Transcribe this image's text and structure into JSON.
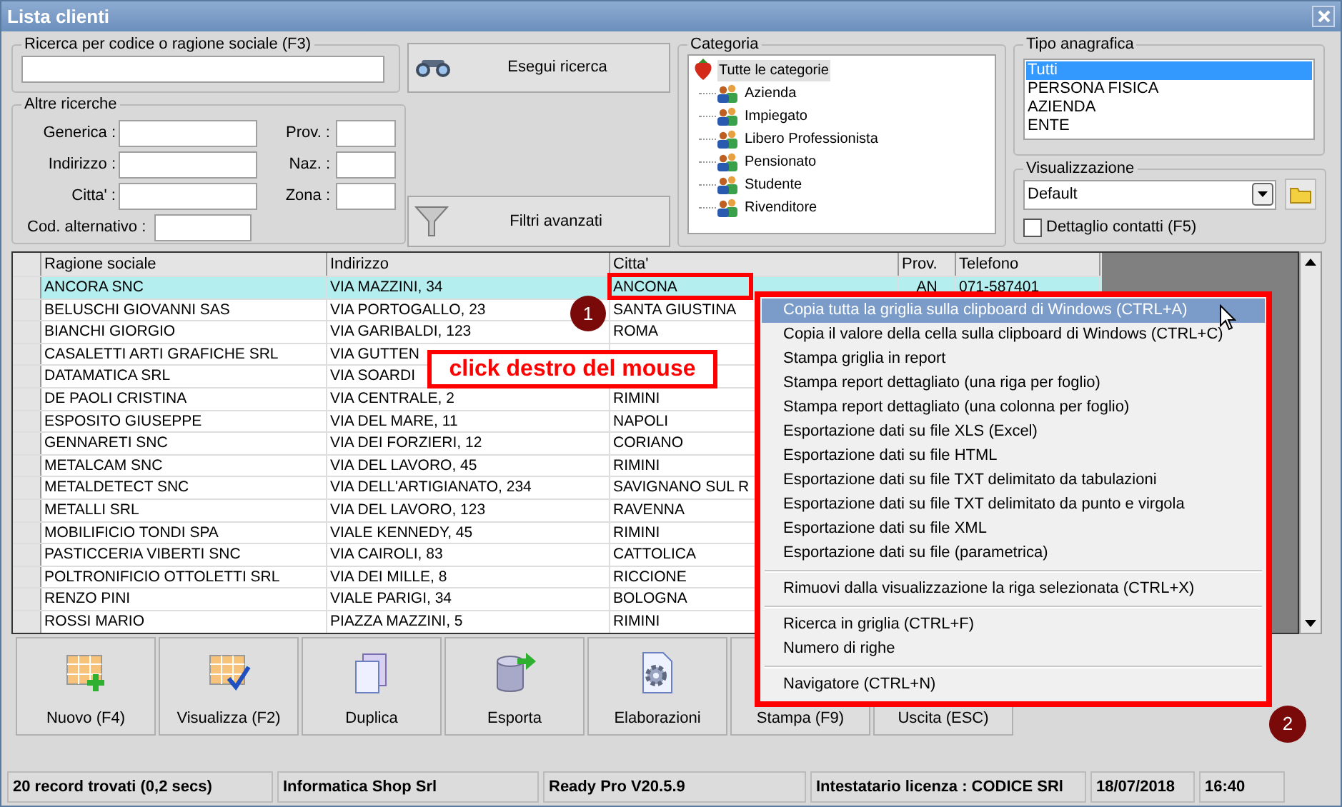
{
  "window": {
    "title": "Lista clienti"
  },
  "search": {
    "legend": "Ricerca per codice o ragione sociale (F3)",
    "button": "Esegui ricerca"
  },
  "other_search": {
    "legend": "Altre ricerche",
    "fields": [
      {
        "label": "Generica :",
        "side_label": "Prov. :"
      },
      {
        "label": "Indirizzo :",
        "side_label": "Naz. :"
      },
      {
        "label": "Citta' :",
        "side_label": "Zona :"
      },
      {
        "label": "Cod. alternativo :"
      }
    ],
    "button": "Filtri avanzati"
  },
  "categoria": {
    "legend": "Categoria",
    "root": {
      "label": "Tutte le categorie",
      "selected": true,
      "children": [
        {
          "label": "Azienda",
          "selected": false
        },
        {
          "label": "Impiegato",
          "selected": false
        },
        {
          "label": "Libero Professionista",
          "selected": false
        },
        {
          "label": "Pensionato",
          "selected": false
        },
        {
          "label": "Studente",
          "selected": false
        },
        {
          "label": "Rivenditore",
          "selected": false
        }
      ]
    }
  },
  "tipo_anagrafica": {
    "legend": "Tipo anagrafica",
    "items": [
      {
        "label": "Tutti",
        "selected": true
      },
      {
        "label": "PERSONA FISICA",
        "selected": false
      },
      {
        "label": "AZIENDA",
        "selected": false
      },
      {
        "label": "ENTE",
        "selected": false
      }
    ]
  },
  "visualizzazione": {
    "legend": "Visualizzazione",
    "value": "Default",
    "checkbox": {
      "label": "Dettaglio contatti (F5)",
      "checked": false
    }
  },
  "table": {
    "columns": [
      "Ragione sociale",
      "Indirizzo",
      "Citta'",
      "Prov.",
      "Telefono"
    ],
    "rows": [
      {
        "cells": [
          "ANCORA SNC",
          "VIA MAZZINI, 34",
          "ANCONA",
          "AN",
          "071-587401"
        ],
        "selected": true
      },
      {
        "cells": [
          "BELUSCHI GIOVANNI SAS",
          "VIA PORTOGALLO, 23",
          "SANTA GIUSTINA"
        ],
        "selected": false
      },
      {
        "cells": [
          "BIANCHI GIORGIO",
          "VIA GARIBALDI, 123",
          "ROMA"
        ],
        "selected": false
      },
      {
        "cells": [
          "CASALETTI ARTI GRAFICHE SRL",
          "VIA GUTTEN"
        ],
        "selected": false
      },
      {
        "cells": [
          "DATAMATICA SRL",
          "VIA SOARDI"
        ],
        "selected": false
      },
      {
        "cells": [
          "DE PAOLI CRISTINA",
          "VIA CENTRALE, 2",
          "RIMINI"
        ],
        "selected": false
      },
      {
        "cells": [
          "ESPOSITO GIUSEPPE",
          "VIA DEL MARE, 11",
          "NAPOLI"
        ],
        "selected": false
      },
      {
        "cells": [
          "GENNARETI SNC",
          "VIA DEI FORZIERI, 12",
          "CORIANO"
        ],
        "selected": false
      },
      {
        "cells": [
          "METALCAM SNC",
          "VIA DEL LAVORO, 45",
          "RIMINI"
        ],
        "selected": false
      },
      {
        "cells": [
          "METALDETECT SNC",
          "VIA DELL'ARTIGIANATO, 234",
          "SAVIGNANO SUL R"
        ],
        "selected": false
      },
      {
        "cells": [
          "METALLI SRL",
          "VIA DEL LAVORO, 123",
          "RAVENNA"
        ],
        "selected": false
      },
      {
        "cells": [
          "MOBILIFICIO TONDI SPA",
          "VIALE KENNEDY, 45",
          "RIMINI"
        ],
        "selected": false
      },
      {
        "cells": [
          "PASTICCERIA VIBERTI SNC",
          "VIA CAIROLI, 83",
          "CATTOLICA"
        ],
        "selected": false
      },
      {
        "cells": [
          "POLTRONIFICIO OTTOLETTI SRL",
          "VIA DEI MILLE, 8",
          "RICCIONE"
        ],
        "selected": false
      },
      {
        "cells": [
          "RENZO PINI",
          "VIALE PARIGI, 34",
          "BOLOGNA"
        ],
        "selected": false
      },
      {
        "cells": [
          "ROSSI MARIO",
          "PIAZZA MAZZINI, 5",
          "RIMINI"
        ],
        "selected": false
      }
    ]
  },
  "context_menu": {
    "items": [
      {
        "kind": "item",
        "label": "Copia tutta la griglia sulla clipboard di Windows (CTRL+A)",
        "selected": true
      },
      {
        "kind": "item",
        "label": "Copia il valore della cella sulla clipboard di Windows (CTRL+C)",
        "selected": false
      },
      {
        "kind": "item",
        "label": "Stampa griglia in report",
        "selected": false
      },
      {
        "kind": "item",
        "label": "Stampa report dettagliato (una riga per foglio)",
        "selected": false
      },
      {
        "kind": "item",
        "label": "Stampa report dettagliato (una colonna per foglio)",
        "selected": false
      },
      {
        "kind": "item",
        "label": "Esportazione dati su file XLS (Excel)",
        "selected": false
      },
      {
        "kind": "item",
        "label": "Esportazione dati su file HTML",
        "selected": false
      },
      {
        "kind": "item",
        "label": "Esportazione dati su file TXT delimitato da tabulazioni",
        "selected": false
      },
      {
        "kind": "item",
        "label": "Esportazione dati su file TXT delimitato da punto e virgola",
        "selected": false
      },
      {
        "kind": "item",
        "label": "Esportazione dati su file XML",
        "selected": false
      },
      {
        "kind": "item",
        "label": "Esportazione dati su file (parametrica)",
        "selected": false
      },
      {
        "kind": "separator"
      },
      {
        "kind": "item",
        "label": "Rimuovi dalla visualizzazione la riga selezionata (CTRL+X)",
        "selected": false
      },
      {
        "kind": "separator"
      },
      {
        "kind": "item",
        "label": "Ricerca in griglia (CTRL+F)",
        "selected": false
      },
      {
        "kind": "item",
        "label": "Numero di righe",
        "selected": false
      },
      {
        "kind": "separator"
      },
      {
        "kind": "item",
        "label": "Navigatore (CTRL+N)",
        "selected": false
      }
    ]
  },
  "annotations": {
    "callout": "click destro del mouse",
    "markers": [
      "1",
      "2"
    ]
  },
  "toolbar": [
    {
      "label": "Nuovo (F4)"
    },
    {
      "label": "Visualizza (F2)"
    },
    {
      "label": "Duplica"
    },
    {
      "label": "Esporta"
    },
    {
      "label": "Elaborazioni"
    },
    {
      "label": "Stampa (F9)"
    },
    {
      "label": "Uscita (ESC)"
    }
  ],
  "status_bar": [
    "20 record trovati (0,2 secs)",
    "Informatica Shop Srl",
    "Ready Pro V20.5.9",
    "Intestatario licenza : CODICE SRl",
    "18/07/2018",
    "16:40"
  ]
}
